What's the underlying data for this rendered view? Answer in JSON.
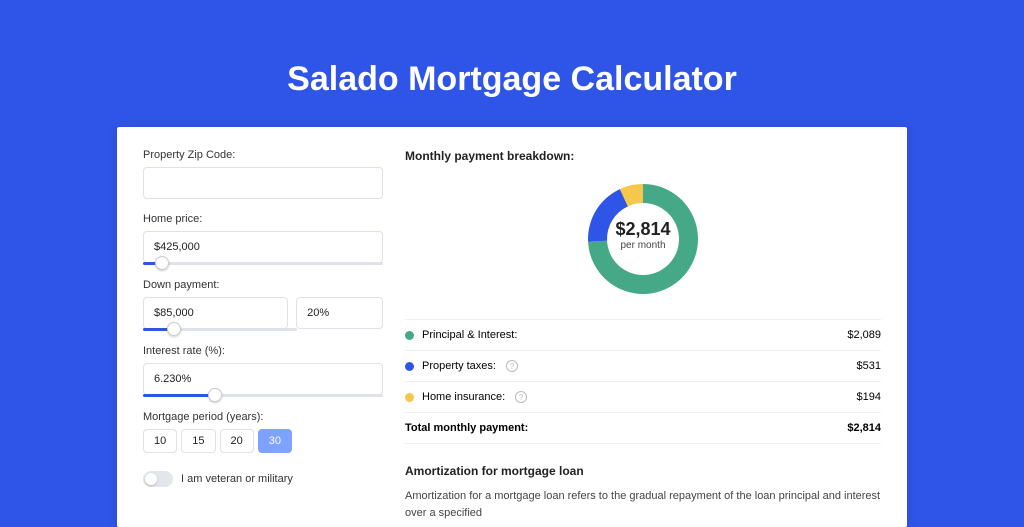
{
  "page_title": "Salado Mortgage Calculator",
  "colors": {
    "accent": "#2f55e8",
    "green": "#45a886",
    "blue": "#2f55e8",
    "yellow": "#f5c84b"
  },
  "form": {
    "zip_label": "Property Zip Code:",
    "zip_value": "",
    "home_price_label": "Home price:",
    "home_price_value": "$425,000",
    "home_price_slider_pct": 8,
    "down_payment_label": "Down payment:",
    "down_payment_value": "$85,000",
    "down_payment_pct_value": "20%",
    "down_payment_slider_pct": 20,
    "interest_label": "Interest rate (%):",
    "interest_value": "6.230%",
    "interest_slider_pct": 30,
    "period_label": "Mortgage period (years):",
    "period_options": [
      "10",
      "15",
      "20",
      "30"
    ],
    "period_selected": "30",
    "veteran_label": "I am veteran or military",
    "veteran_checked": false
  },
  "breakdown": {
    "heading": "Monthly payment breakdown:",
    "total_amount": "$2,814",
    "total_sub": "per month",
    "items": [
      {
        "label": "Principal & Interest:",
        "value": "$2,089",
        "color": "green"
      },
      {
        "label": "Property taxes:",
        "value": "$531",
        "color": "blue",
        "info": true
      },
      {
        "label": "Home insurance:",
        "value": "$194",
        "color": "yellow",
        "info": true
      }
    ],
    "total_label": "Total monthly payment:",
    "total_value": "$2,814"
  },
  "chart_data": {
    "type": "pie",
    "title": "Monthly payment breakdown",
    "series": [
      {
        "name": "Principal & Interest",
        "value": 2089,
        "color": "#45a886"
      },
      {
        "name": "Property taxes",
        "value": 531,
        "color": "#2f55e8"
      },
      {
        "name": "Home insurance",
        "value": 194,
        "color": "#f5c84b"
      }
    ],
    "center_label": "$2,814",
    "center_sub": "per month"
  },
  "amortization": {
    "heading": "Amortization for mortgage loan",
    "text": "Amortization for a mortgage loan refers to the gradual repayment of the loan principal and interest over a specified"
  }
}
